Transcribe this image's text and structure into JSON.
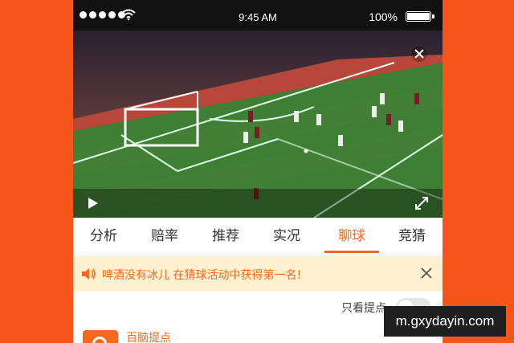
{
  "status_bar": {
    "time": "9:45 AM",
    "battery_pct": "100%",
    "signal_dots": 5
  },
  "video": {
    "description_icon": "soccer-match-video",
    "close_icon": "close-icon",
    "play_icon": "play-icon",
    "fullscreen_icon": "expand-icon"
  },
  "tabs": [
    {
      "label": "分析"
    },
    {
      "label": "赔率"
    },
    {
      "label": "推荐"
    },
    {
      "label": "实况"
    },
    {
      "label": "聊球",
      "active": true
    },
    {
      "label": "竞猜"
    }
  ],
  "notice": {
    "text": "啤酒没有冰儿 在猜球活动中获得第一名!",
    "icon": "speaker-icon"
  },
  "filter": {
    "label": "只看提点"
  },
  "feed": {
    "first_item_name": "百脑提点"
  },
  "watermark": {
    "text": "m.gxydayin.com"
  },
  "colors": {
    "accent": "#f36a1f",
    "background": "#f6561b",
    "notice_bg": "#fff0cf"
  }
}
